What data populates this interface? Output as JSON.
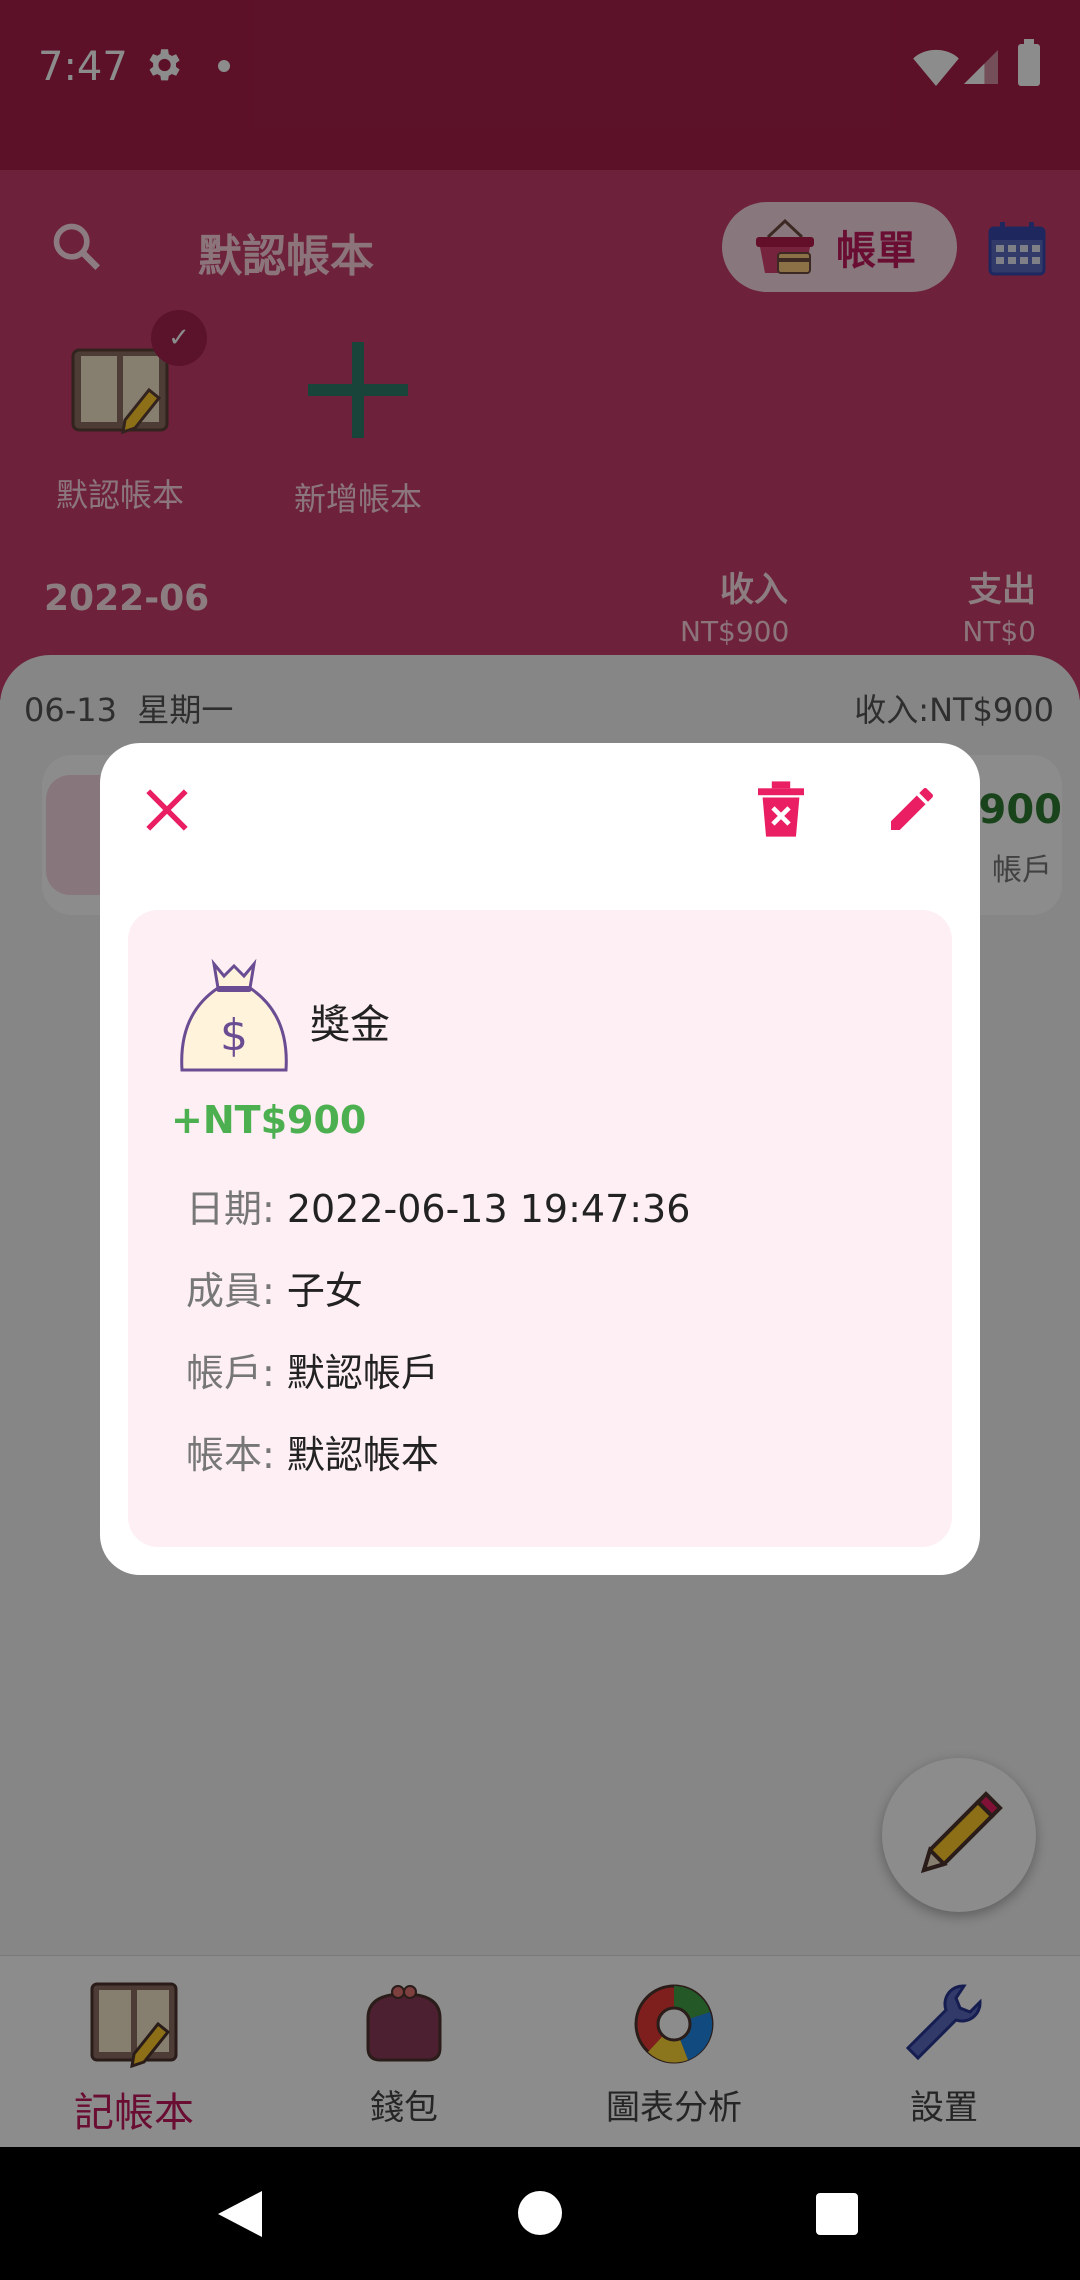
{
  "status_bar": {
    "time": "7:47"
  },
  "header": {
    "title": "默認帳本",
    "bill_button": "帳單",
    "books": [
      {
        "label": "默認帳本",
        "selected": true
      },
      {
        "label": "新增帳本",
        "selected": false
      }
    ],
    "month": "2022-06",
    "income": {
      "label": "收入",
      "value": "NT$900"
    },
    "expense": {
      "label": "支出",
      "value": "NT$0"
    }
  },
  "list": {
    "day": "06-13",
    "weekday": "星期一",
    "day_summary": "收入:NT$900",
    "transaction": {
      "amount": "900",
      "account": "帳戶"
    }
  },
  "bottom_nav": [
    {
      "label": "記帳本",
      "icon": "ledger-book-icon",
      "active": true
    },
    {
      "label": "錢包",
      "icon": "purse-icon",
      "active": false
    },
    {
      "label": "圖表分析",
      "icon": "pie-chart-icon",
      "active": false
    },
    {
      "label": "設置",
      "icon": "wrench-icon",
      "active": false
    }
  ],
  "dialog": {
    "category": "獎金",
    "amount": "+NT$900",
    "fields": [
      {
        "key": "日期:",
        "value": "2022-06-13 19:47:36"
      },
      {
        "key": "成員:",
        "value": "子女"
      },
      {
        "key": "帳戶:",
        "value": "默認帳戶"
      },
      {
        "key": "帳本:",
        "value": "默認帳本"
      }
    ]
  },
  "colors": {
    "primary": "#c83d6a",
    "accent": "#e91e63",
    "income_green": "#4caf50",
    "dialog_inner": "#fdeff3"
  }
}
